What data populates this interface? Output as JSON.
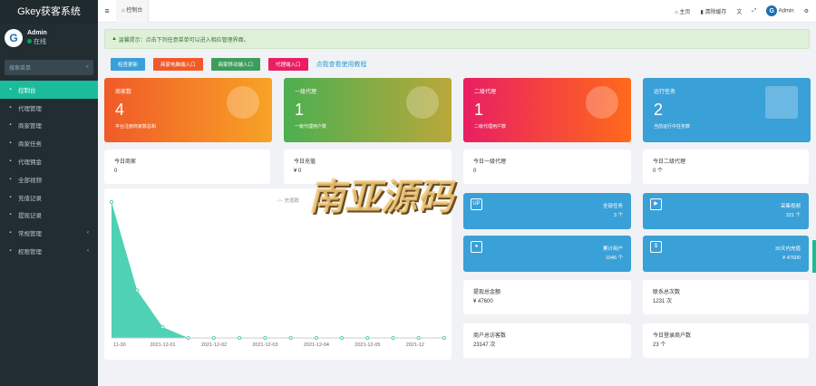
{
  "brand": "Gkey获客系统",
  "user": {
    "name": "Admin",
    "status": "在线"
  },
  "search": {
    "placeholder": "搜索菜单"
  },
  "nav": [
    {
      "label": "控制台",
      "icon": "dashboard-icon"
    },
    {
      "label": "代理管理",
      "icon": "users-icon"
    },
    {
      "label": "商家管理",
      "icon": "eye-icon"
    },
    {
      "label": "商家任务",
      "icon": "list-icon"
    },
    {
      "label": "代理佣金",
      "icon": "gem-icon"
    },
    {
      "label": "全部视频",
      "icon": "video-icon"
    },
    {
      "label": "充值记录",
      "icon": "dollar-icon"
    },
    {
      "label": "提现记录",
      "icon": "paper-plane-icon"
    },
    {
      "label": "常规管理",
      "icon": "gear-icon"
    },
    {
      "label": "权限管理",
      "icon": "group-icon"
    }
  ],
  "topbar": {
    "tab": "控制台",
    "home": "主页",
    "clear": "清除缓存",
    "admin": "Admin"
  },
  "alert": "温馨提示：点击下列任意菜单可以进入相应管理界面。",
  "buttons": [
    "检查更新",
    "商家电脑端入口",
    "商家移动端入口",
    "代理端入口"
  ],
  "help_link": "点我查看使用教程",
  "stats": [
    {
      "title": "商家数",
      "value": "4",
      "sub": "平台注册商家数总和",
      "color": "#f05a28"
    },
    {
      "title": "一级代理",
      "value": "1",
      "sub": "一级代理用户数",
      "color": "#4caf50"
    },
    {
      "title": "二级代理",
      "value": "1",
      "sub": "二级代理用户数",
      "color": "#e91e63"
    },
    {
      "title": "运行任务",
      "value": "2",
      "sub": "当前运行中任务数",
      "color": "#3aa0d8"
    }
  ],
  "today": [
    {
      "label": "今日商家",
      "value": "0"
    },
    {
      "label": "今日充值",
      "value": "¥ 0"
    },
    {
      "label": "今日一级代理",
      "value": "0"
    },
    {
      "label": "今日二级代理",
      "value": "0 个"
    }
  ],
  "minis": [
    {
      "label": "全部任务",
      "value": "3 个"
    },
    {
      "label": "采集视频",
      "value": "321 个"
    },
    {
      "label": "累计用户",
      "value": "1046 个"
    },
    {
      "label": "30天内充值",
      "value": "¥ 47600"
    }
  ],
  "bottom": [
    {
      "label": "提现总金额",
      "value": "¥ 47600"
    },
    {
      "label": "联系总次数",
      "value": "1231 次"
    },
    {
      "label": "商户总访客数",
      "value": "23147 次"
    },
    {
      "label": "今日登录商户数",
      "value": "23 个"
    }
  ],
  "watermark": "南亚源码",
  "chart_data": {
    "type": "area",
    "series": [
      {
        "name": "充值数",
        "values": [
          100,
          35,
          8,
          0,
          0,
          0,
          0,
          0,
          0,
          0,
          0,
          0,
          0,
          0
        ]
      }
    ],
    "x": [
      "11-30",
      "",
      "2021-12-01",
      "",
      "2021-12-02",
      "",
      "2021-12-03",
      "",
      "2021-12-04",
      "",
      "2021-12-05",
      "",
      "2021-12"
    ],
    "color": "#4fd1b4"
  }
}
